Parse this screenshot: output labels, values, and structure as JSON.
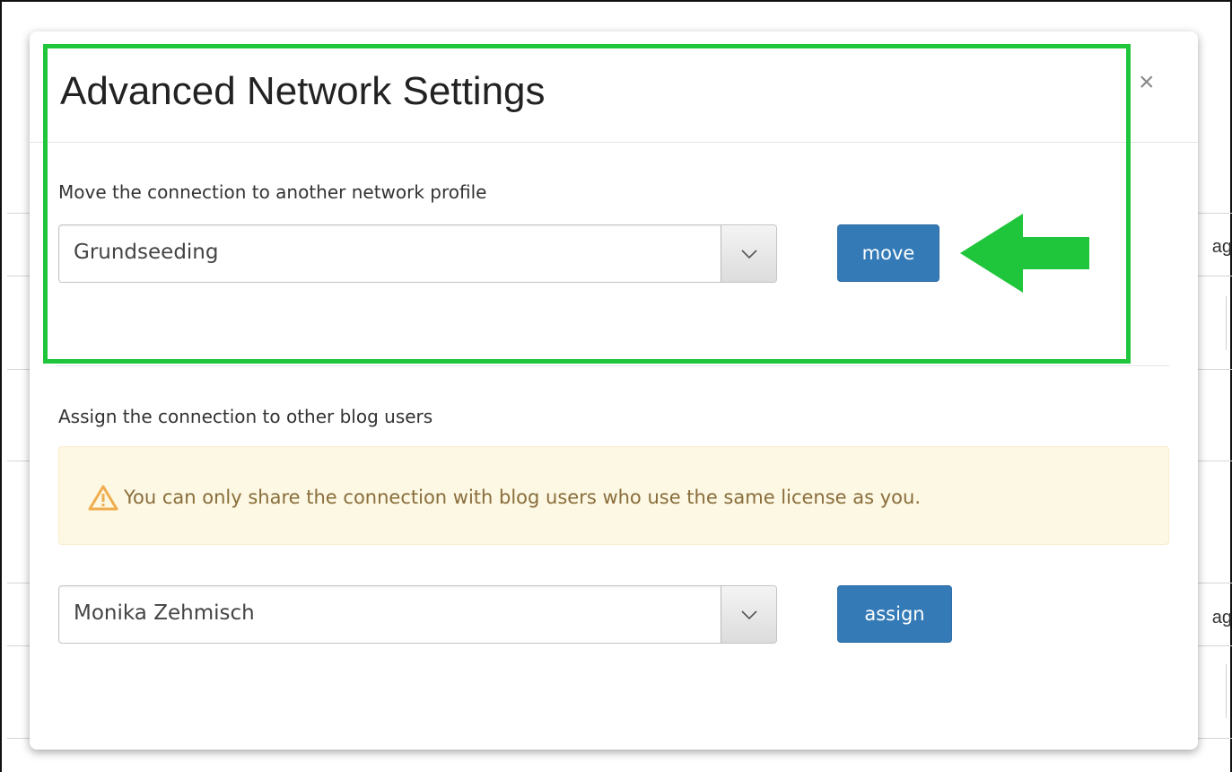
{
  "background": {
    "row_text_1": "ag",
    "row_text_2": "ag"
  },
  "dialog": {
    "title": "Advanced Network Settings",
    "close_symbol": "×",
    "move_section": {
      "label": "Move the connection to another network profile",
      "selected_profile": "Grundseeding",
      "button_label": "move"
    },
    "assign_section": {
      "label": "Assign the connection to other blog users",
      "warning_text": "You can only share the connection with blog users who use the same license as you.",
      "selected_user": "Monika Zehmisch",
      "button_label": "assign"
    }
  },
  "colors": {
    "primary_button": "#337ab7",
    "warning_bg": "#fcf8e3",
    "warning_text": "#8a6d3b",
    "warning_icon": "#f0ad4e",
    "annotation_green": "#1fc53a"
  },
  "icons": {
    "close": "close-icon",
    "dropdown": "chevron-down-icon",
    "warning": "warning-triangle-icon",
    "annotation": "arrow-left-icon"
  }
}
